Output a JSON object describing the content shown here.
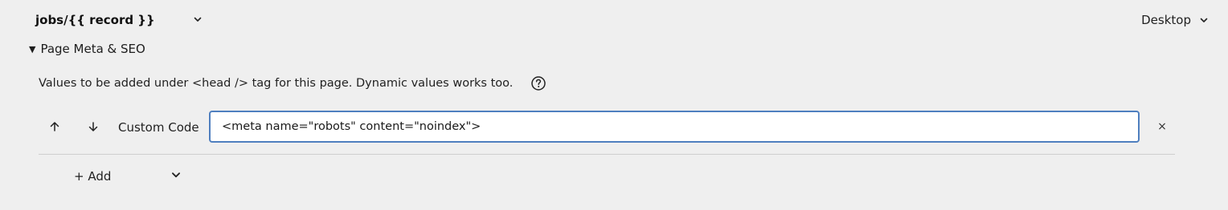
{
  "header": {
    "page_path": "jobs/{{ record }}",
    "page_path_icon": "chevron-down-icon",
    "device": "Desktop",
    "device_icon": "chevron-down-icon"
  },
  "section": {
    "toggle_icon": "triangle-down",
    "title": "Page Meta & SEO",
    "description": "Values to be added under <head /> tag for this page. Dynamic values works too.",
    "help_icon": "question-circle-icon"
  },
  "meta_rows": [
    {
      "up_icon": "arrow-up-icon",
      "down_icon": "arrow-down-icon",
      "label": "Custom Code",
      "value": "<meta name=\"robots\" content=\"noindex\">",
      "remove_label": "×"
    }
  ],
  "add": {
    "label": "+ Add",
    "icon": "chevron-down-icon"
  },
  "colors": {
    "background": "#efefef",
    "input_border": "#4f7fbf",
    "divider": "#cfcfcf"
  }
}
